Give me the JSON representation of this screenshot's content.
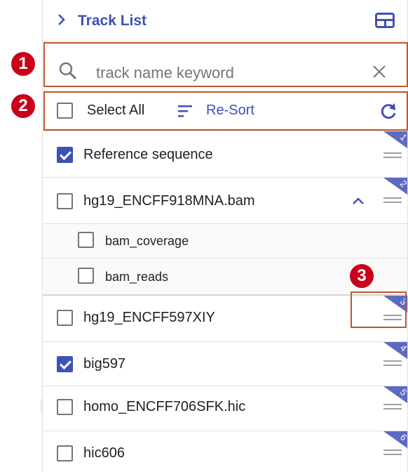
{
  "header": {
    "title": "Track List"
  },
  "search": {
    "placeholder": "track name keyword",
    "value": ""
  },
  "select_bar": {
    "select_all_label": "Select All",
    "resort_label": "Re-Sort"
  },
  "tracks": [
    {
      "label": "Reference sequence",
      "checked": true,
      "order": "1"
    },
    {
      "label": "hg19_ENCFF918MNA.bam",
      "checked": false,
      "order": "2",
      "expanded": true,
      "children": [
        {
          "label": "bam_coverage",
          "checked": false
        },
        {
          "label": "bam_reads",
          "checked": false
        }
      ]
    },
    {
      "label": "hg19_ENCFF597XIY",
      "checked": false,
      "order": "3"
    },
    {
      "label": "big597",
      "checked": true,
      "order": "4"
    },
    {
      "label": "homo_ENCFF706SFK.hic",
      "checked": false,
      "order": "5"
    },
    {
      "label": "hic606",
      "checked": false,
      "order": "6"
    }
  ],
  "annotations": {
    "badge_1": "1",
    "badge_2": "2",
    "badge_3": "3"
  },
  "colors": {
    "accent": "#3f51b5",
    "annotation_box": "#c0562a",
    "badge": "#c9001a"
  },
  "icons": [
    "chevron-right-icon",
    "layout-toggle-icon",
    "search-icon",
    "close-icon",
    "sort-icon",
    "refresh-icon",
    "chevron-up-icon",
    "drag-handle-icon"
  ]
}
